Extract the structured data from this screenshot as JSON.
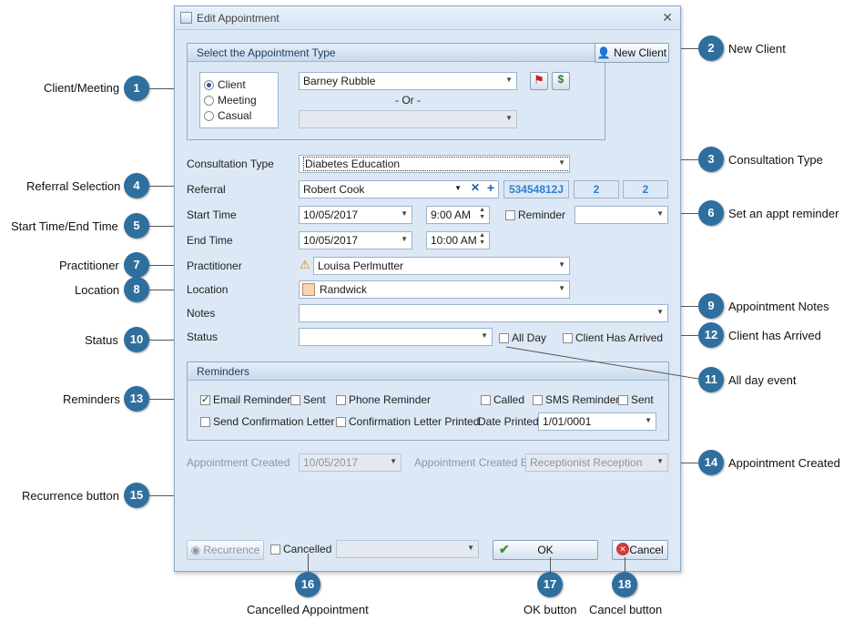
{
  "dialog": {
    "title": "Edit Appointment",
    "close": "✕",
    "new_client_label": "New Client",
    "appt_type": {
      "header": "Select the Appointment Type",
      "options": [
        "Client",
        "Meeting",
        "Casual"
      ],
      "selected": "Client",
      "client_value": "Barney Rubble",
      "or_text": "- Or -"
    },
    "fields": {
      "consultation_type_label": "Consultation Type",
      "consultation_type_value": "Diabetes Education",
      "referral_label": "Referral",
      "referral_value": "Robert Cook",
      "referral_code": "53454812J",
      "referral_count1": "2",
      "referral_count2": "2",
      "start_time_label": "Start Time",
      "start_date": "10/05/2017",
      "start_time": "9:00 AM",
      "reminder_label": "Reminder",
      "end_time_label": "End Time",
      "end_date": "10/05/2017",
      "end_time": "10:00 AM",
      "practitioner_label": "Practitioner",
      "practitioner_value": "Louisa Perlmutter",
      "location_label": "Location",
      "location_value": "Randwick",
      "notes_label": "Notes",
      "status_label": "Status",
      "all_day_label": "All Day",
      "client_arrived_label": "Client Has Arrived"
    },
    "reminders": {
      "header": "Reminders",
      "email_reminder": "Email Reminder",
      "sent1": "Sent",
      "phone_reminder": "Phone Reminder",
      "called": "Called",
      "sms_reminder": "SMS Reminder",
      "sent2": "Sent",
      "send_confirmation": "Send Confirmation Letter",
      "confirmation_printed": "Confirmation Letter Printed",
      "date_printed_label": "Date Printed",
      "date_printed_value": "1/01/0001"
    },
    "created": {
      "created_label": "Appointment Created",
      "created_value": "10/05/2017",
      "created_by_label": "Appointment Created By",
      "created_by_value": "Receptionist Reception"
    },
    "footer": {
      "recurrence": "Recurrence",
      "cancelled": "Cancelled",
      "ok": "OK",
      "cancel": "Cancel"
    }
  },
  "callouts": [
    {
      "n": "1",
      "text": "Client/Meeting"
    },
    {
      "n": "2",
      "text": "New Client"
    },
    {
      "n": "3",
      "text": "Consultation Type"
    },
    {
      "n": "4",
      "text": "Referral Selection"
    },
    {
      "n": "5",
      "text": "Start Time/End Time"
    },
    {
      "n": "6",
      "text": "Set an appt reminder"
    },
    {
      "n": "7",
      "text": "Practitioner"
    },
    {
      "n": "8",
      "text": "Location"
    },
    {
      "n": "9",
      "text": "Appointment Notes"
    },
    {
      "n": "10",
      "text": "Status"
    },
    {
      "n": "11",
      "text": "All day event"
    },
    {
      "n": "12",
      "text": "Client has Arrived"
    },
    {
      "n": "13",
      "text": "Reminders"
    },
    {
      "n": "14",
      "text": "Appointment Created"
    },
    {
      "n": "15",
      "text": "Recurrence button"
    },
    {
      "n": "16",
      "text": "Cancelled Appointment"
    },
    {
      "n": "17",
      "text": "OK button"
    },
    {
      "n": "18",
      "text": "Cancel button"
    }
  ],
  "colors": {
    "callout": "#2f6f9e",
    "dialog_bg": "#dce8f5",
    "link_blue": "#2f7fd0"
  }
}
